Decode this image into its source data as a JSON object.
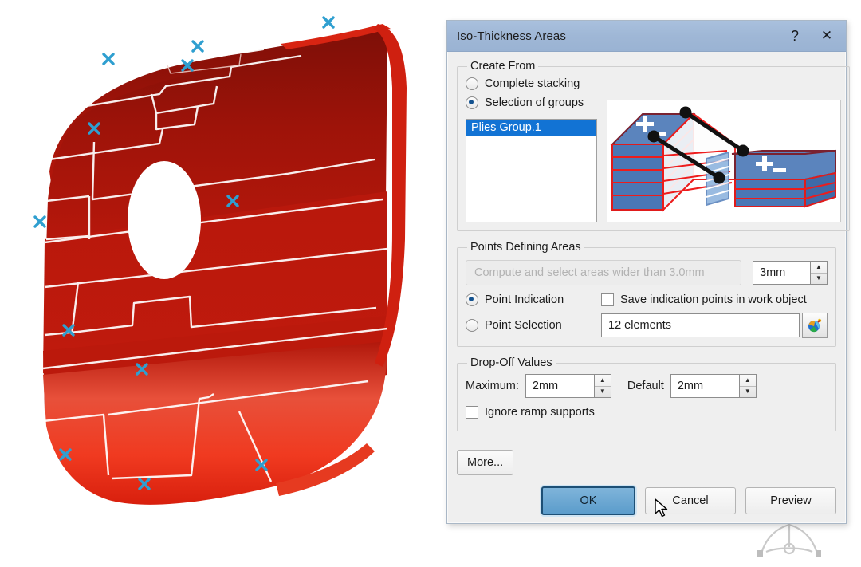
{
  "dialog": {
    "title": "Iso-Thickness Areas",
    "help_icon": "question-mark-icon",
    "close_icon": "close-icon"
  },
  "create_from": {
    "legend": "Create From",
    "options": [
      {
        "label": "Complete stacking",
        "selected": false
      },
      {
        "label": "Selection of groups",
        "selected": true
      }
    ],
    "list": {
      "items": [
        {
          "label": "Plies Group.1",
          "selected": true
        }
      ]
    },
    "preview_image": "composite-plies-stacking-illustration"
  },
  "points_defining_areas": {
    "legend": "Points Defining Areas",
    "compute_button": {
      "label": "Compute and select areas wider than 3.0mm",
      "enabled": false
    },
    "width_spinner": {
      "value": "3mm"
    },
    "point_indication": {
      "label": "Point Indication",
      "selected": true
    },
    "point_selection": {
      "label": "Point Selection",
      "selected": false
    },
    "save_points_checkbox": {
      "label": "Save indication points in work object",
      "checked": false
    },
    "elements_field": {
      "value": "12 elements"
    },
    "picker_icon": "selection-tool-icon"
  },
  "drop_off_values": {
    "legend": "Drop-Off Values",
    "maximum_label": "Maximum:",
    "maximum_value": "2mm",
    "default_label": "Default",
    "default_value": "2mm",
    "ignore_ramp_supports": {
      "label": "Ignore ramp supports",
      "checked": false
    }
  },
  "footer": {
    "more_label": "More...",
    "ok_label": "OK",
    "cancel_label": "Cancel",
    "preview_label": "Preview"
  },
  "viewport": {
    "model": "curved-red-composite-panel",
    "indication_point_marker": "x-marker",
    "indication_points_count": 12,
    "compass_widget": "3d-compass-icon"
  },
  "colors": {
    "titlebar": "#9fb7d6",
    "selection_blue": "#1273d4",
    "ok_button_blue": "#5b9ccb",
    "model_red": "#b51a0f",
    "marker_cyan": "#2f9fd0"
  }
}
